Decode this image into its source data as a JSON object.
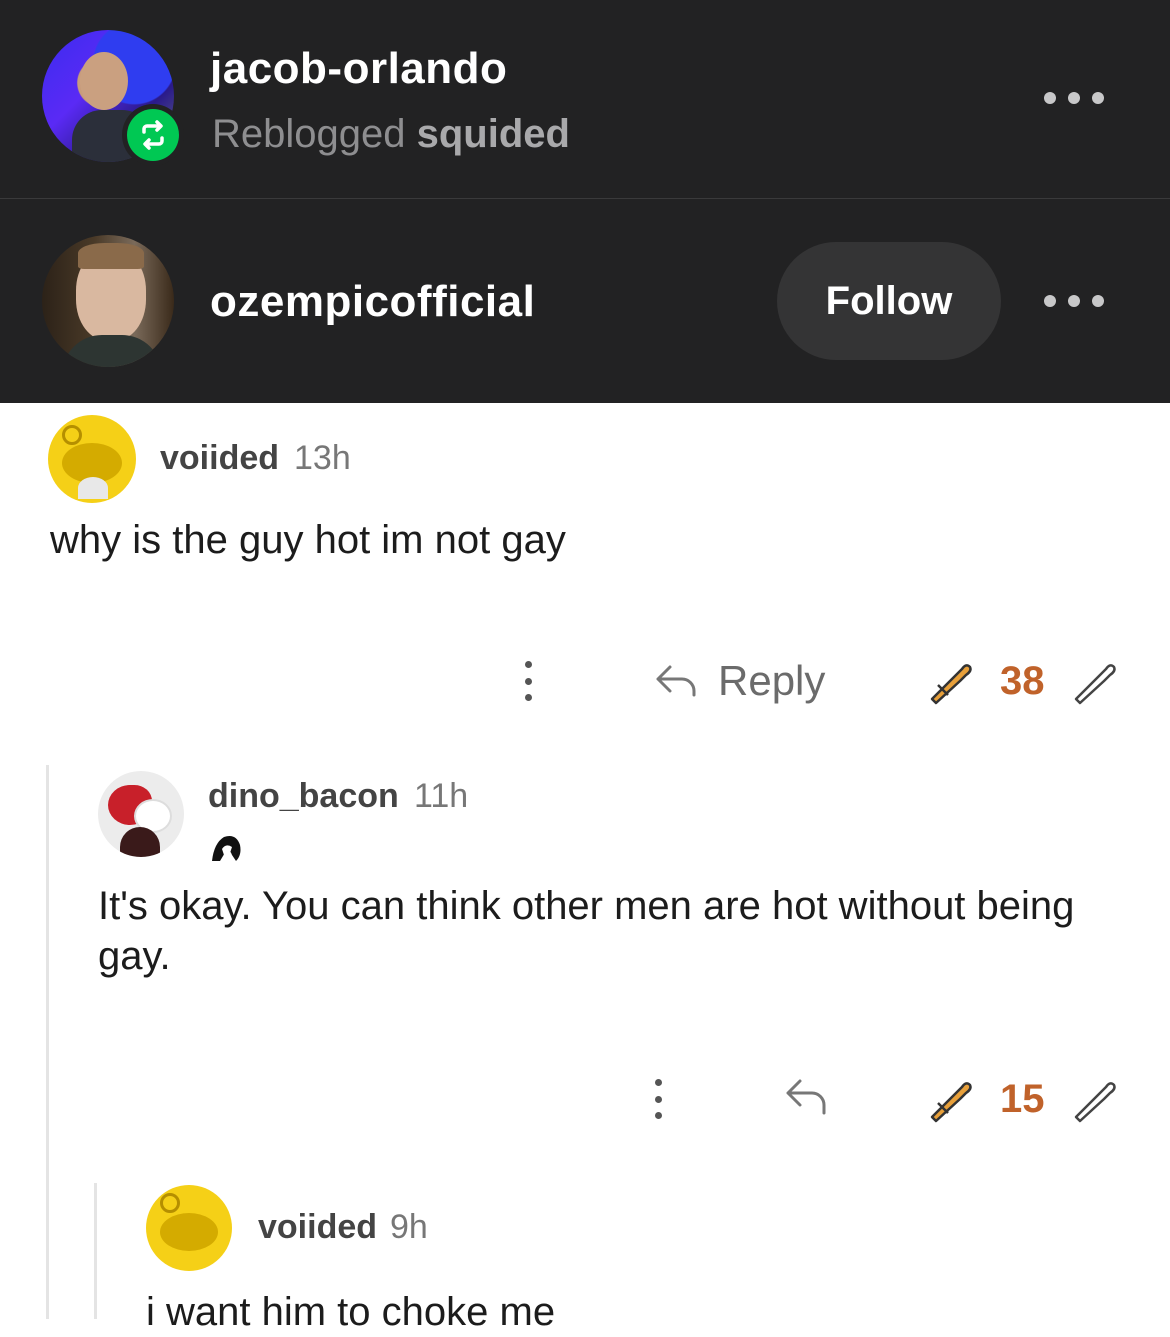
{
  "reblog_header": {
    "reblogger": "jacob-orlando",
    "reblogged_prefix": "Reblogged",
    "reblogged_from": "squided",
    "original_poster": "ozempicofficial",
    "follow_label": "Follow"
  },
  "comments": [
    {
      "user": "voiided",
      "time": "13h",
      "text": "why is the guy hot im not gay",
      "reply_label": "Reply",
      "score": "38"
    },
    {
      "user": "dino_bacon",
      "time": "11h",
      "text": "It's okay. You can think other men are hot without being gay.",
      "score": "15"
    },
    {
      "user": "voiided",
      "time": "9h",
      "text": "i want him to choke me"
    }
  ],
  "colors": {
    "header_bg": "#222223",
    "reblog_green": "#00c853",
    "score_orange": "#c0622a"
  }
}
